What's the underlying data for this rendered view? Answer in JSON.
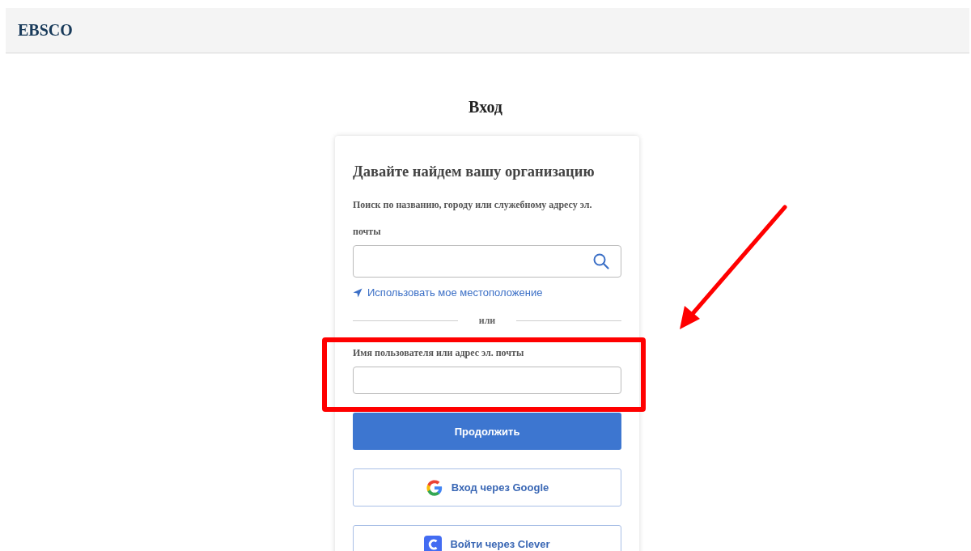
{
  "header": {
    "logo": "EBSCO"
  },
  "page": {
    "title": "Вход"
  },
  "card": {
    "heading": "Давайте найдем вашу организацию",
    "search": {
      "label": "Поиск по названию, городу или служебному адресу эл. почты"
    },
    "location_link": "Использовать мое местоположение",
    "divider": "или",
    "username": {
      "label": "Имя пользователя или адрес эл. почты"
    },
    "continue_button": "Продолжить",
    "sso_buttons": [
      {
        "kind": "google",
        "label": "Вход через Google"
      },
      {
        "kind": "clever",
        "label": "Войти через Clever"
      }
    ]
  },
  "annotations": {
    "highlight_frame": true,
    "pointer_arrow": true
  }
}
